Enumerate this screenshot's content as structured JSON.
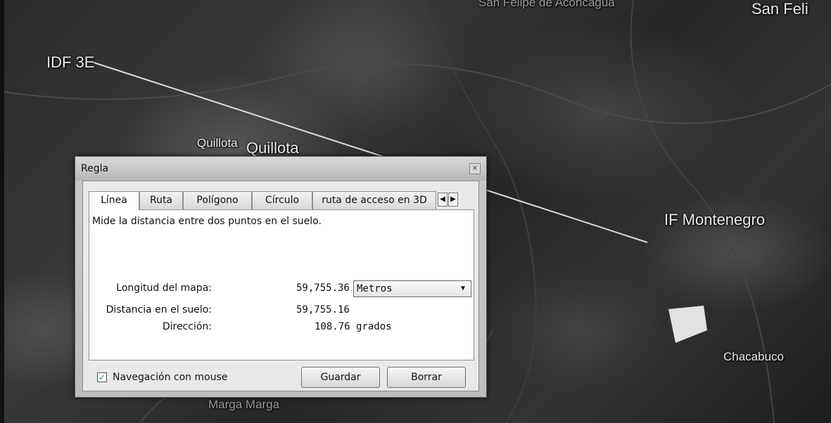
{
  "map": {
    "places": {
      "idf": "IDF 3E",
      "quillota_small": "Quillota",
      "quillota_big": "Quillota",
      "montenegro": "IF Montenegro",
      "chacabuco": "Chacabuco",
      "san_felipe": "San Feli",
      "san_felipe_top": "San Felipe de Aconcagua",
      "marga": "Marga Marga"
    }
  },
  "dialog": {
    "title": "Regla",
    "close_glyph": "×",
    "tabs": [
      "Línea",
      "Ruta",
      "Polígono",
      "Círculo",
      "ruta de acceso en 3D"
    ],
    "active_tab": "Línea",
    "description": "Mide la distancia entre dos puntos en el suelo.",
    "map_length_label": "Longitud del mapa:",
    "map_length_value": "59,755.36",
    "unit_selected": "Metros",
    "ground_distance_label": "Distancia en el suelo:",
    "ground_distance_value": "59,755.16",
    "direction_label": "Dirección:",
    "direction_value": "108.76 grados",
    "mouse_nav_label": "Navegación con mouse",
    "mouse_nav_checked": true,
    "save_label": "Guardar",
    "delete_label": "Borrar"
  }
}
